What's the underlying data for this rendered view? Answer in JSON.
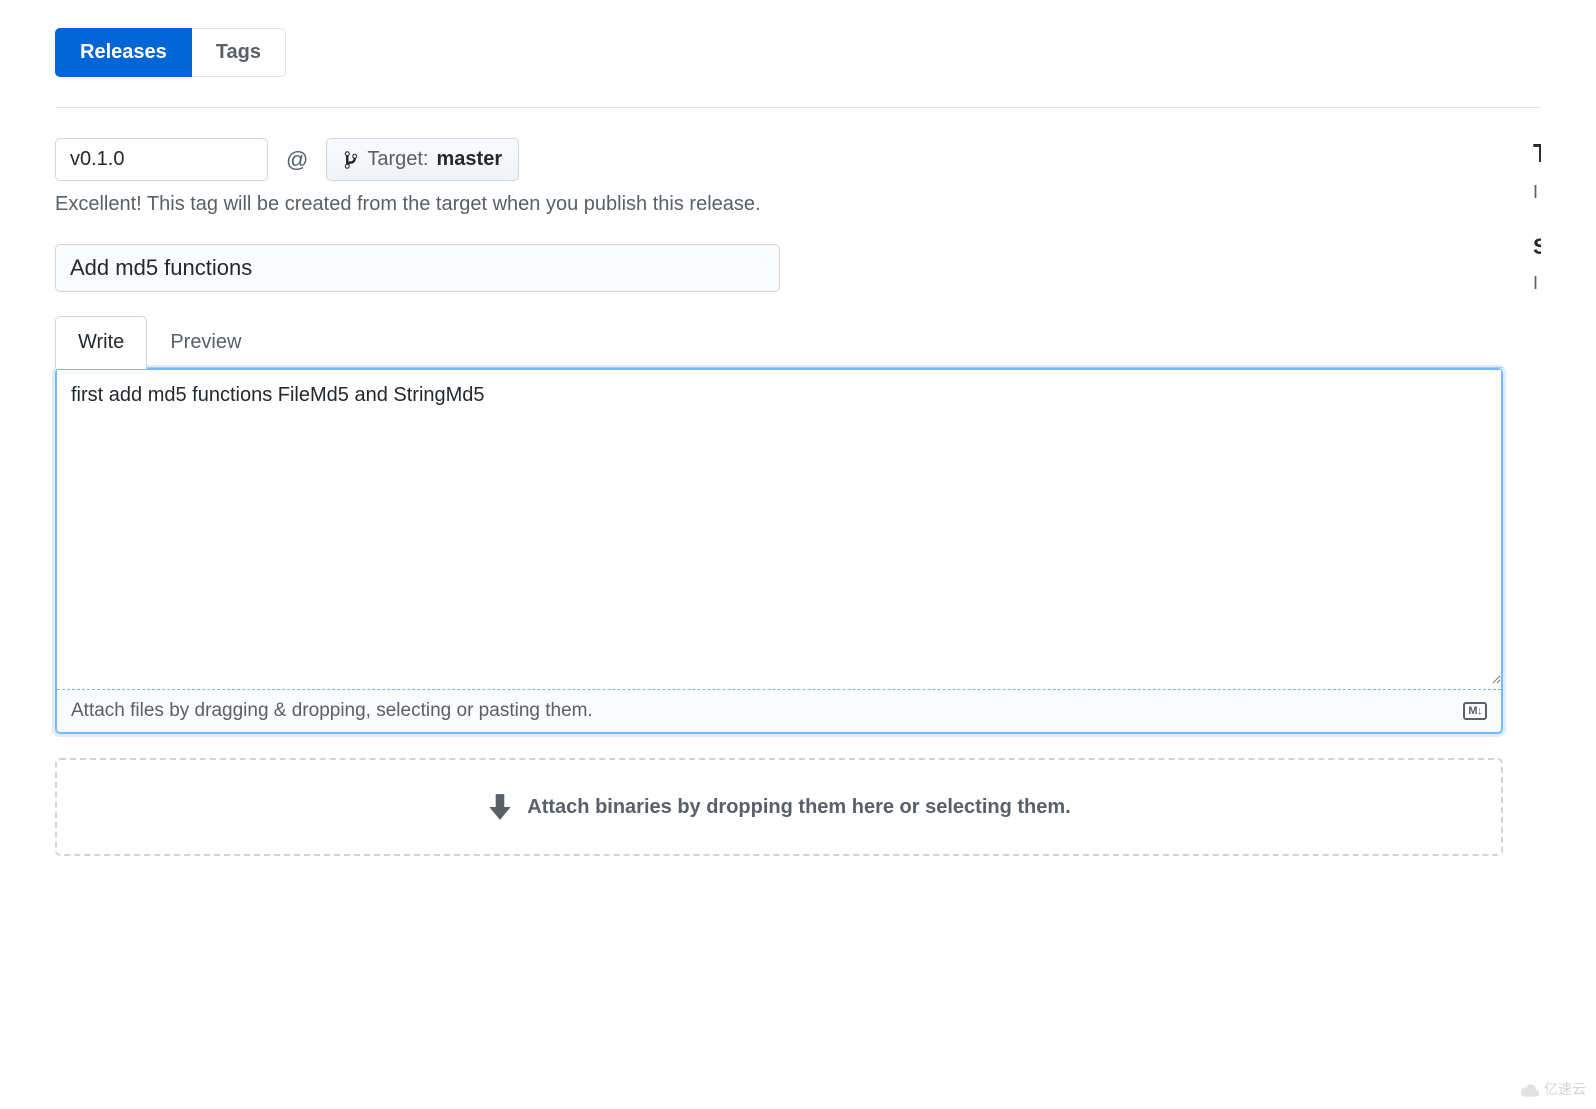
{
  "navTabs": {
    "releases": "Releases",
    "tags": "Tags"
  },
  "tagRow": {
    "tagVersion": "v0.1.0",
    "at": "@",
    "targetLabel": "Target:",
    "targetBranch": "master"
  },
  "hint": "Excellent! This tag will be created from the target when you publish this release.",
  "releaseTitle": "Add md5 functions",
  "editor": {
    "writeTab": "Write",
    "previewTab": "Preview",
    "description": "first add md5 functions FileMd5 and StringMd5",
    "attachHint": "Attach files by dragging & dropping, selecting or pasting them.",
    "markdownLabel": "M↓"
  },
  "binariesHint": "Attach binaries by dropping them here or selecting them.",
  "sidebar": {
    "heading1": "T",
    "para1": "I",
    "heading2": "S",
    "para2": "I"
  },
  "watermark": "亿速云"
}
